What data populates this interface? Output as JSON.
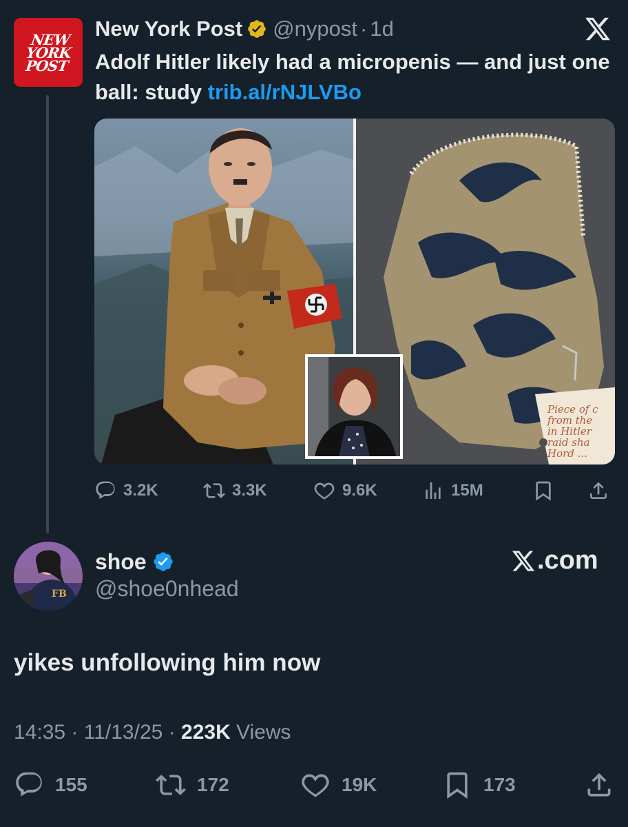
{
  "parent_tweet": {
    "avatar_logo_lines": [
      "NEW",
      "YORK",
      "POST"
    ],
    "name": "New York Post",
    "handle": "@nypost",
    "separator": "·",
    "time": "1d",
    "text": "Adolf Hitler likely had a micropenis — and just one ball: study ",
    "link": "trib.al/rNJLVBo",
    "actions": {
      "replies": "3.2K",
      "reposts": "3.3K",
      "likes": "9.6K",
      "views": "15M"
    },
    "media_note_lines": [
      "Piece of c",
      "from the",
      "in Hitler",
      "raid sha",
      "Hord ..."
    ]
  },
  "main_tweet": {
    "name": "shoe",
    "handle": "@shoe0nhead",
    "brand": ".com",
    "text": "yikes unfollowing him now",
    "time": "14:35",
    "date": "11/13/25",
    "separator": "·",
    "views_count": "223K",
    "views_label": "Views",
    "actions": {
      "replies": "155",
      "reposts": "172",
      "likes": "19K",
      "bookmarks": "173"
    }
  },
  "colors": {
    "background": "#15202b",
    "text_primary": "#e7e9ea",
    "text_secondary": "#8b98a5",
    "link": "#1d9bf0",
    "verified_gold": "#e2b719",
    "verified_blue": "#1d9bf0",
    "nypost_red": "#d0161e"
  }
}
